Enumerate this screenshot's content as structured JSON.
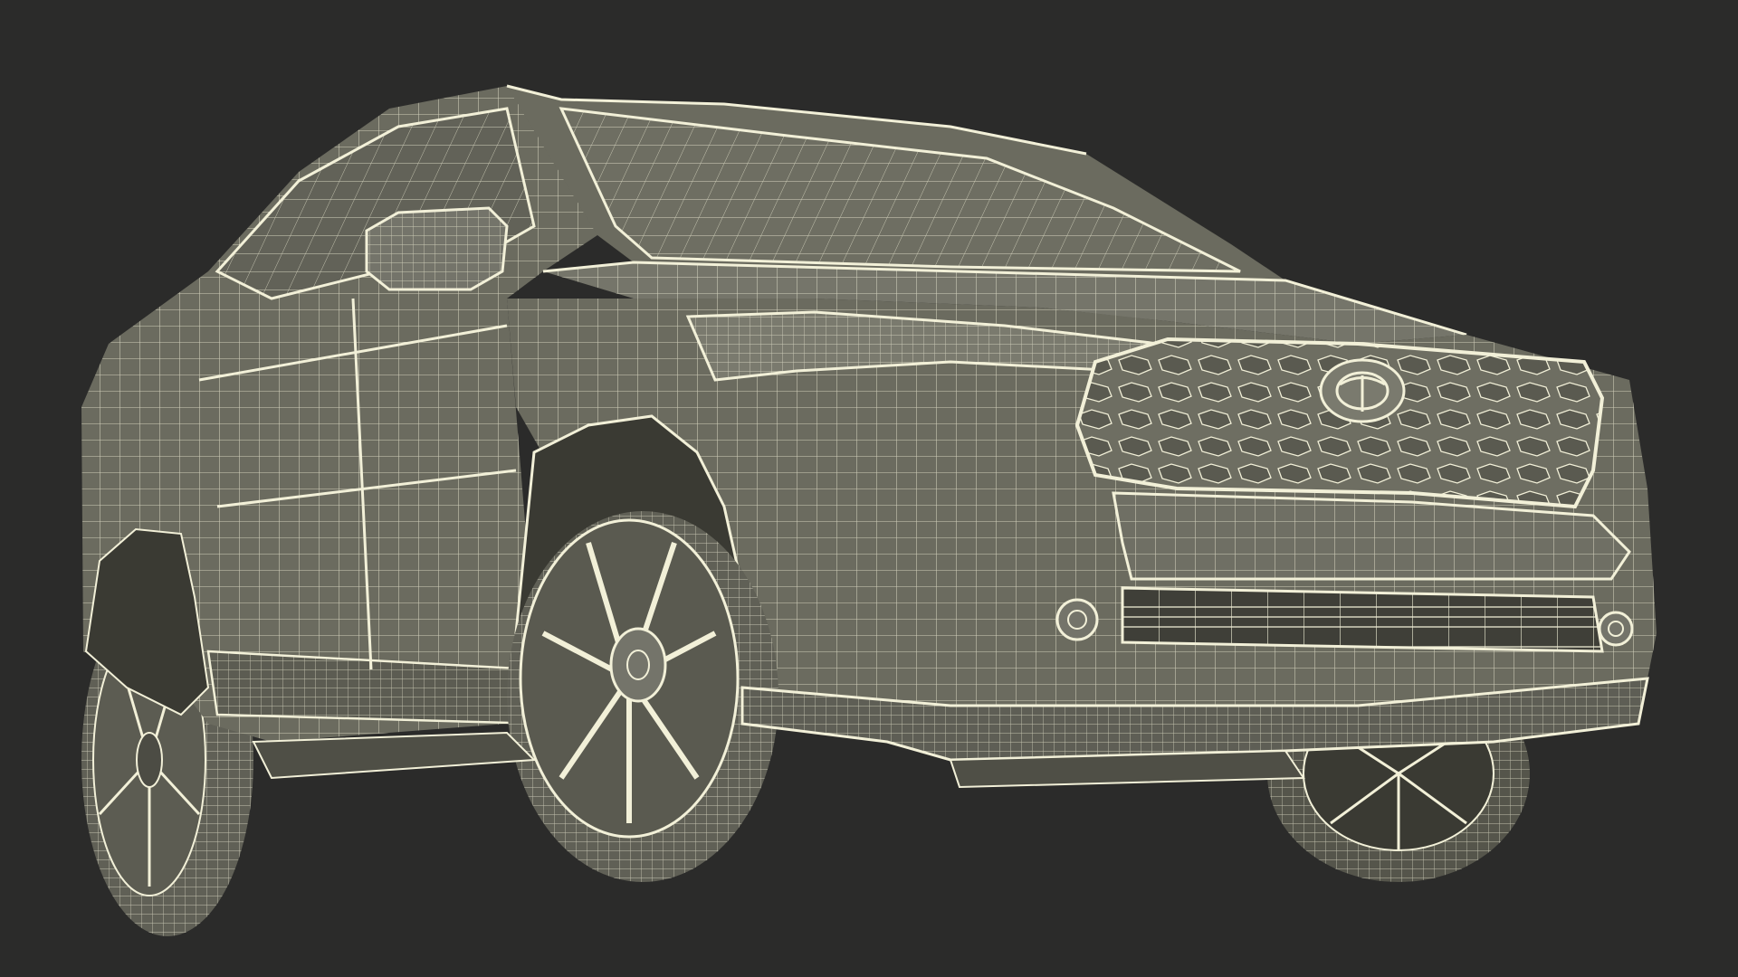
{
  "scene": {
    "subject": "suv-wireframe-render",
    "view": "front-three-quarter-low",
    "colors": {
      "background": "#2b2b2a",
      "body_fill": "#6b6b5f",
      "body_shade": "#4f4f46",
      "body_light": "#7e7e71",
      "wire": "#f2f0d8",
      "dark_cavity": "#3a3a33"
    }
  }
}
